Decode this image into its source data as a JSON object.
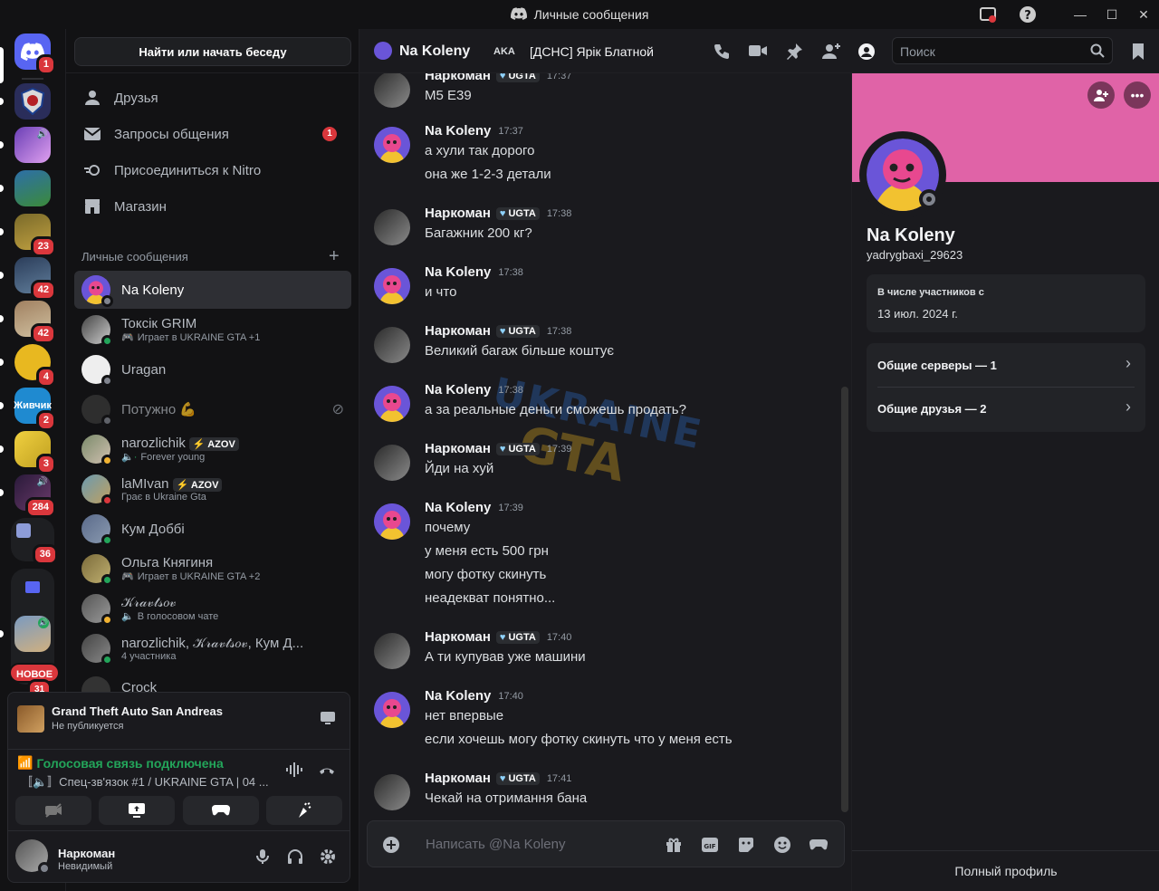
{
  "window": {
    "title": "Личные сообщения"
  },
  "servers": {
    "badges": [
      "1",
      "23",
      "42",
      "42",
      "4",
      "2",
      "3",
      "284",
      "36",
      "31"
    ],
    "new_label": "НОВОЕ"
  },
  "dm": {
    "search_label": "Найти или начать беседу",
    "nav": [
      {
        "label": "Друзья"
      },
      {
        "label": "Запросы общения",
        "badge": "1"
      },
      {
        "label": "Присоединиться к Nitro"
      },
      {
        "label": "Магазин"
      }
    ],
    "section_title": "Личные сообщения",
    "rows": [
      {
        "name": "Na Koleny",
        "sub": ""
      },
      {
        "name": "Toксік GRIM",
        "sub": "Играет в UKRAINE GTA +1"
      },
      {
        "name": "Uragan",
        "sub": ""
      },
      {
        "name": "Потужно 💪",
        "sub": ""
      },
      {
        "name": "narozlichik",
        "tag": "⚡ AZOV",
        "sub": "Forever young"
      },
      {
        "name": "laMIvan",
        "tag": "⚡ AZOV",
        "sub": "Грає в Ukraine Gta"
      },
      {
        "name": "Кум Доббі",
        "sub": ""
      },
      {
        "name": "Ольга Княгиня",
        "sub": "Играет в UKRAINE GTA +2"
      },
      {
        "name": "𝒦𝓇𝒶𝓋𝓉𝓈𝑜𝓋",
        "sub": "В голосовом чате"
      },
      {
        "name": "narozlichik, 𝒦𝓇𝒶𝓋𝓉𝓈𝑜𝓋, Кум Д...",
        "sub": "4 участника"
      },
      {
        "name": "Crock",
        "sub": ""
      }
    ]
  },
  "activity": {
    "game": "Grand Theft Auto San Andreas",
    "status": "Не публикуется"
  },
  "voice": {
    "status": "Голосовая связь подключена",
    "channel": "〚🔈〛Спец-зв'язок #1 / UKRAINE GTA | 04 ..."
  },
  "user": {
    "name": "Наркоман",
    "status": "Невидимый"
  },
  "chat_header": {
    "name": "Na Koleny",
    "aka_label": "AKA",
    "aka": "[ДСНС] Ярік Блатной",
    "search_placeholder": "Поиск"
  },
  "messages": [
    {
      "author": "Наркоман",
      "tag": "UGTA",
      "time": "17:37",
      "lines": [
        "M5 E39"
      ]
    },
    {
      "author": "Na Koleny",
      "time": "17:37",
      "lines": [
        "а хули так дорого",
        "она же 1-2-3 детали"
      ]
    },
    {
      "author": "Наркоман",
      "tag": "UGTA",
      "time": "17:38",
      "lines": [
        "Багажник 200 кг?"
      ]
    },
    {
      "author": "Na Koleny",
      "time": "17:38",
      "lines": [
        "и что"
      ]
    },
    {
      "author": "Наркоман",
      "tag": "UGTA",
      "time": "17:38",
      "lines": [
        "Великий багаж більше коштує"
      ]
    },
    {
      "author": "Na Koleny",
      "time": "17:38",
      "lines": [
        "а за реальные деньги сможешь продать?"
      ]
    },
    {
      "author": "Наркоман",
      "tag": "UGTA",
      "time": "17:39",
      "lines": [
        "Йди на хуй"
      ]
    },
    {
      "author": "Na Koleny",
      "time": "17:39",
      "lines": [
        "почему",
        "у меня есть 500 грн",
        "могу фотку скинуть",
        "неадекват понятно..."
      ]
    },
    {
      "author": "Наркоман",
      "tag": "UGTA",
      "time": "17:40",
      "lines": [
        "А ти купував уже машини"
      ]
    },
    {
      "author": "Na Koleny",
      "time": "17:40",
      "lines": [
        "нет впервые",
        "если хочешь могу фотку скинуть что у меня есть"
      ]
    },
    {
      "author": "Наркоман",
      "tag": "UGTA",
      "time": "17:41",
      "lines": [
        "Чекай на отримання бана"
      ]
    }
  ],
  "watermark": {
    "line1": "UKRAINE",
    "line2": "GTA"
  },
  "composer": {
    "placeholder": "Написать @Na Koleny"
  },
  "profile": {
    "name": "Na Koleny",
    "username": "yadrygbaxi_29623",
    "member_since_label": "В числе участников с",
    "member_since": "13 июл. 2024 г.",
    "mutual_servers": "Общие серверы — 1",
    "mutual_friends": "Общие друзья — 2",
    "full_profile": "Полный профиль"
  },
  "colors": {
    "accent": "#5865f2",
    "banner": "#e063a7",
    "online": "#23a55a",
    "danger": "#da373c",
    "voice": "#23a55a"
  }
}
